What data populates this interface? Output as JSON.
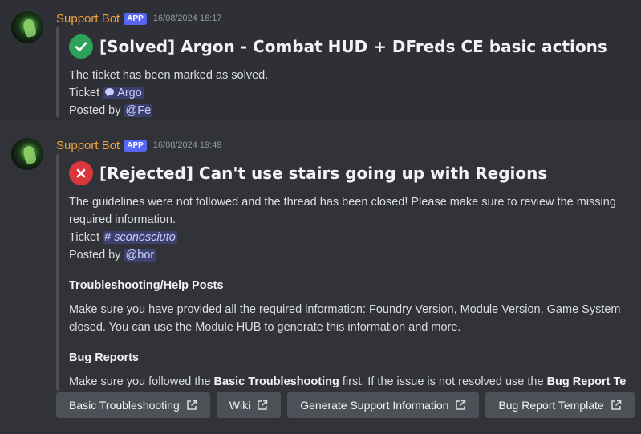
{
  "messages": [
    {
      "username": "Support Bot",
      "badge": "APP",
      "timestamp": "16/08/2024 16:17",
      "embed": {
        "title": "[Solved] Argon - Combat HUD + DFreds CE basic actions",
        "status_icon": "check-icon",
        "description": "The ticket has been marked as solved.",
        "ticket_label": "Ticket",
        "ticket_channel": "Argo",
        "posted_by_label": "Posted by",
        "posted_by_user": "@Fe"
      }
    },
    {
      "username": "Support Bot",
      "badge": "APP",
      "timestamp": "16/08/2024 19:49",
      "embed": {
        "title": "[Rejected] Can't use stairs going up with Regions",
        "status_icon": "cross-icon",
        "description_line1": "The guidelines were not followed and the thread has been closed! Please make sure to review the missing",
        "description_line2": "required information.",
        "ticket_label": "Ticket",
        "ticket_channel": "sconosciuto",
        "posted_by_label": "Posted by",
        "posted_by_user": "@bor",
        "section1_title": "Troubleshooting/Help Posts",
        "section1_prefix": "Make sure you have provided all the required information: ",
        "section1_link1": "Foundry Version",
        "section1_sep1": ", ",
        "section1_link2": "Module Version",
        "section1_sep2": ", ",
        "section1_link3": "Game System",
        "section1_line2": "closed. You can use the Module HUB to generate this information and more.",
        "section2_title": "Bug Reports",
        "section2_prefix": "Make sure you followed the ",
        "section2_bold1": "Basic Troubleshooting",
        "section2_mid": " first. If the issue is not resolved use the ",
        "section2_bold2": "Bug Report Te"
      }
    }
  ],
  "buttons": [
    {
      "label": "Basic Troubleshooting"
    },
    {
      "label": "Wiki"
    },
    {
      "label": "Generate Support Information"
    },
    {
      "label": "Bug Report Template"
    }
  ],
  "colors": {
    "background": "#313338",
    "username": "#f0a340",
    "badge": "#5865f2",
    "success": "#2da25a",
    "danger": "#da373c",
    "button": "#4e5058"
  }
}
